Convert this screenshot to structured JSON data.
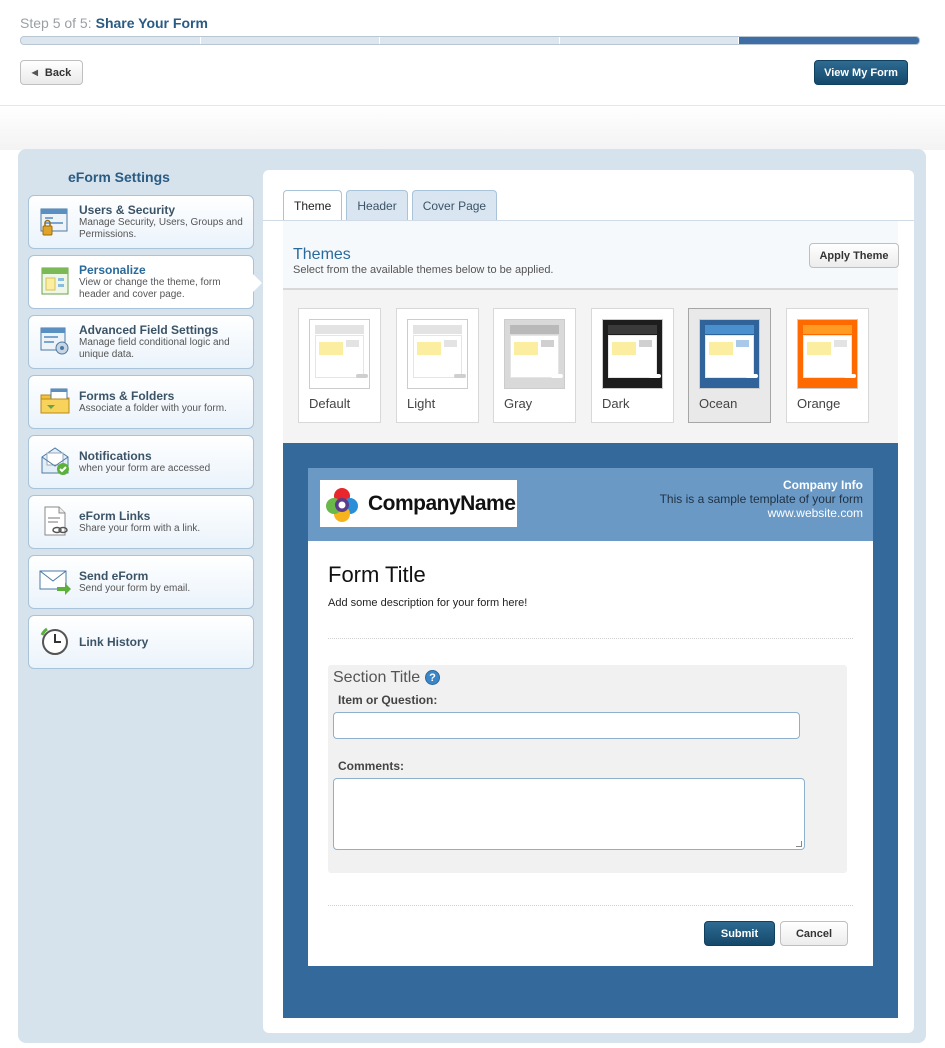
{
  "wizard": {
    "step_prefix": "Step 5 of 5:",
    "step_title": "Share Your Form",
    "progress_current": 5,
    "progress_total": 5,
    "back_label": "Back",
    "view_form_label": "View My Form"
  },
  "sidebar": {
    "title": "eForm Settings",
    "items": [
      {
        "title": "Users & Security",
        "desc": "Manage Security, Users, Groups and Permissions.",
        "icon": "users-security-icon"
      },
      {
        "title": "Personalize",
        "desc": "View or change the theme, form header and cover page.",
        "icon": "personalize-icon",
        "active": true
      },
      {
        "title": "Advanced Field Settings",
        "desc": "Manage field conditional logic and unique data.",
        "icon": "advanced-settings-icon"
      },
      {
        "title": "Forms & Folders",
        "desc": "Associate a folder with your form.",
        "icon": "folder-icon"
      },
      {
        "title": "Notifications",
        "desc": "when your form are accessed",
        "icon": "notifications-icon"
      },
      {
        "title": "eForm Links",
        "desc": "Share your form with a link.",
        "icon": "link-icon"
      },
      {
        "title": "Send eForm",
        "desc": "Send your form by email.",
        "icon": "envelope-icon"
      },
      {
        "title": "Link History",
        "desc": "",
        "icon": "clock-icon"
      }
    ]
  },
  "tabs": [
    {
      "label": "Theme",
      "active": true
    },
    {
      "label": "Header"
    },
    {
      "label": "Cover Page"
    }
  ],
  "themes": {
    "heading": "Themes",
    "subtitle": "Select from the available themes below to be applied.",
    "apply_label": "Apply Theme",
    "selected": "Ocean",
    "items": [
      {
        "name": "Default",
        "header": "#e3e3e3",
        "body": "#ffffff",
        "accent": "#e3e3e3",
        "pill": "#cfcfcf",
        "frame": "#ffffff"
      },
      {
        "name": "Light",
        "header": "#e3e3e3",
        "body": "#ffffff",
        "accent": "#e3e3e3",
        "pill": "#cfcfcf",
        "frame": "#ffffff"
      },
      {
        "name": "Gray",
        "header": "#b9b9b9",
        "body": "#ffffff",
        "accent": "#d0d0d0",
        "pill": "#ffffff",
        "frame": "#d9d9d9"
      },
      {
        "name": "Dark",
        "header": "#3a3a3a",
        "body": "#ffffff",
        "accent": "#d0d0d0",
        "pill": "#ffffff",
        "frame": "#1d1d1d"
      },
      {
        "name": "Ocean",
        "header": "#4a90cf",
        "body": "#ffffff",
        "accent": "#a9c9e8",
        "pill": "#ffffff",
        "frame": "#2f6399"
      },
      {
        "name": "Orange",
        "header": "#ff9a22",
        "body": "#ffffff",
        "accent": "#e3e3e3",
        "pill": "#ffffff",
        "frame": "#ff6a00"
      }
    ]
  },
  "preview": {
    "company_name": "CompanyName",
    "company_info_title": "Company Info",
    "company_info_text": "This is a sample template of your form",
    "company_website": "www.website.com",
    "form_title": "Form Title",
    "form_description": "Add some description for your form here!",
    "section_title": "Section Title",
    "help_glyph": "?",
    "question_label": "Item or Question:",
    "comments_label": "Comments:",
    "submit_label": "Submit",
    "cancel_label": "Cancel"
  },
  "colors": {
    "accent": "#2a5b83",
    "preview_frame": "#34699b",
    "header_band": "#6a99c6"
  }
}
